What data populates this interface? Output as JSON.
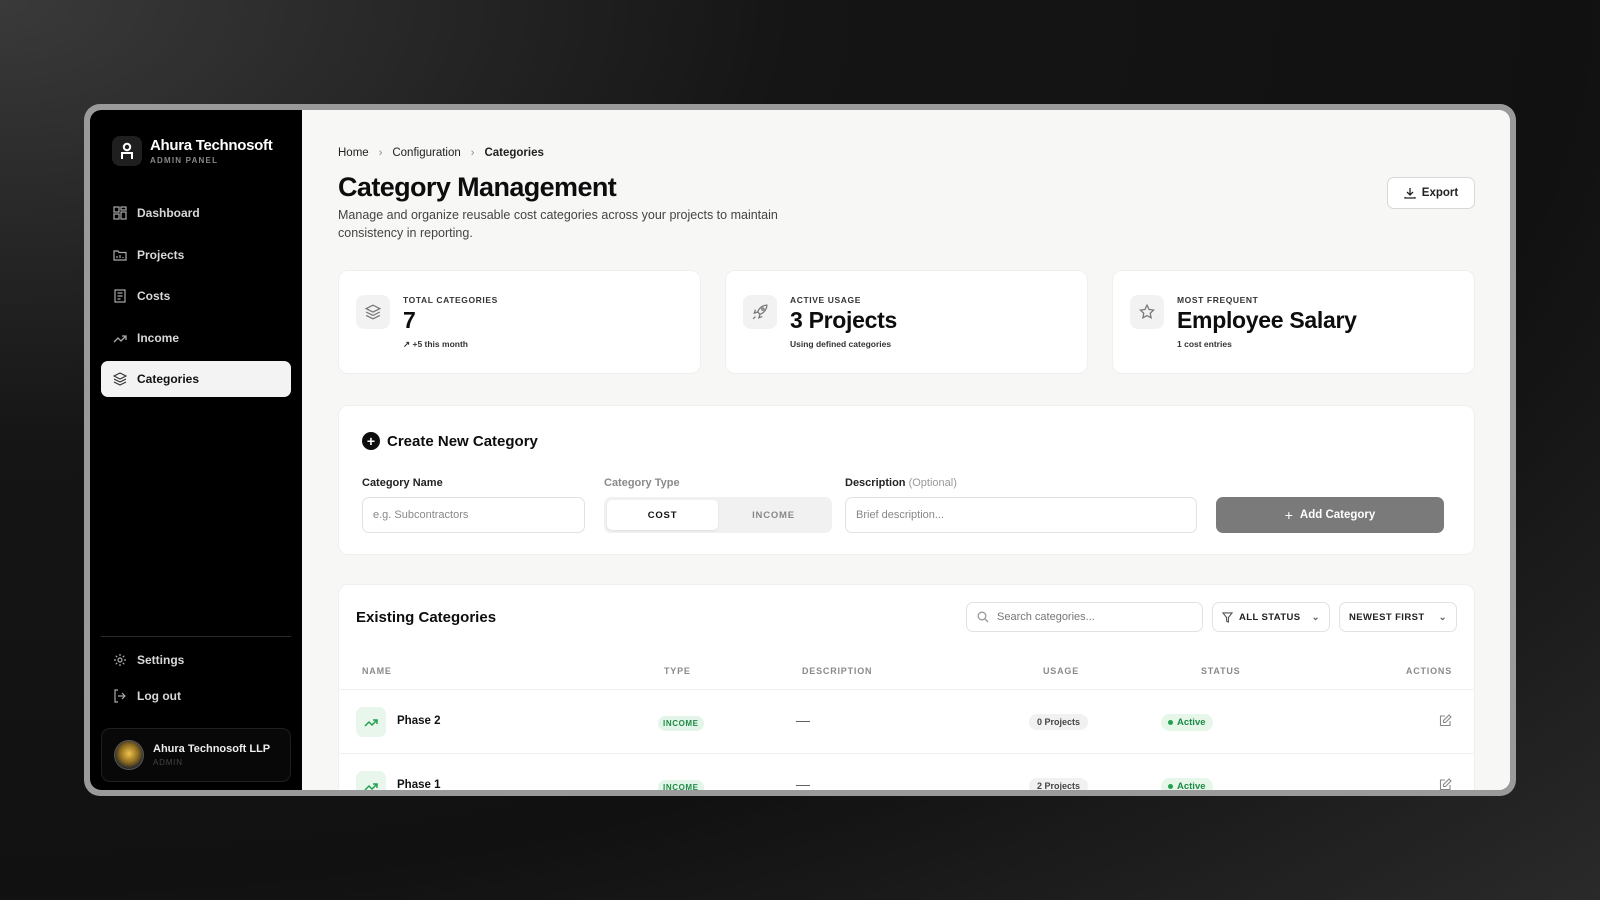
{
  "brand": {
    "name": "Ahura Technosoft",
    "subtitle": "ADMIN PANEL"
  },
  "sidebar": {
    "items": [
      {
        "label": "Dashboard",
        "icon": "grid-icon"
      },
      {
        "label": "Projects",
        "icon": "folder-icon"
      },
      {
        "label": "Costs",
        "icon": "receipt-icon"
      },
      {
        "label": "Income",
        "icon": "trending-up-icon"
      },
      {
        "label": "Categories",
        "icon": "layers-icon",
        "active": true
      }
    ],
    "bottom": [
      {
        "label": "Settings",
        "icon": "gear-icon"
      },
      {
        "label": "Log out",
        "icon": "logout-icon"
      }
    ],
    "user": {
      "name": "Ahura Technosoft LLP",
      "role": "ADMIN"
    }
  },
  "breadcrumb": [
    "Home",
    "Configuration",
    "Categories"
  ],
  "header": {
    "title": "Category Management",
    "description": "Manage and organize reusable cost categories across your projects to maintain consistency in reporting.",
    "export_label": "Export"
  },
  "stats": [
    {
      "label": "TOTAL CATEGORIES",
      "value": "7",
      "sub": "+5 this month",
      "icon": "layers-icon"
    },
    {
      "label": "ACTIVE USAGE",
      "value": "3 Projects",
      "sub": "Using defined categories",
      "icon": "rocket-icon"
    },
    {
      "label": "MOST FREQUENT",
      "value": "Employee Salary",
      "sub": "1 cost entries",
      "icon": "star-icon"
    }
  ],
  "create": {
    "title": "Create New Category",
    "name_label": "Category Name",
    "name_placeholder": "e.g. Subcontractors",
    "type_label": "Category Type",
    "type_options": [
      "COST",
      "INCOME"
    ],
    "type_selected": "COST",
    "desc_label": "Description",
    "desc_optional": "(Optional)",
    "desc_placeholder": "Brief description...",
    "add_label": "Add Category"
  },
  "table": {
    "title": "Existing Categories",
    "search_placeholder": "Search categories...",
    "status_filter": "ALL STATUS",
    "sort": "NEWEST FIRST",
    "columns": [
      "NAME",
      "TYPE",
      "DESCRIPTION",
      "USAGE",
      "STATUS",
      "ACTIONS"
    ],
    "rows": [
      {
        "name": "Phase 2",
        "type": "INCOME",
        "description": "—",
        "usage": "0 Projects",
        "status": "Active"
      },
      {
        "name": "Phase 1",
        "type": "INCOME",
        "description": "—",
        "usage": "2 Projects",
        "status": "Active"
      }
    ]
  },
  "colors": {
    "sidebar_bg": "#000000",
    "accent_green": "#1f8a46",
    "add_button": "#7a7a7a"
  }
}
